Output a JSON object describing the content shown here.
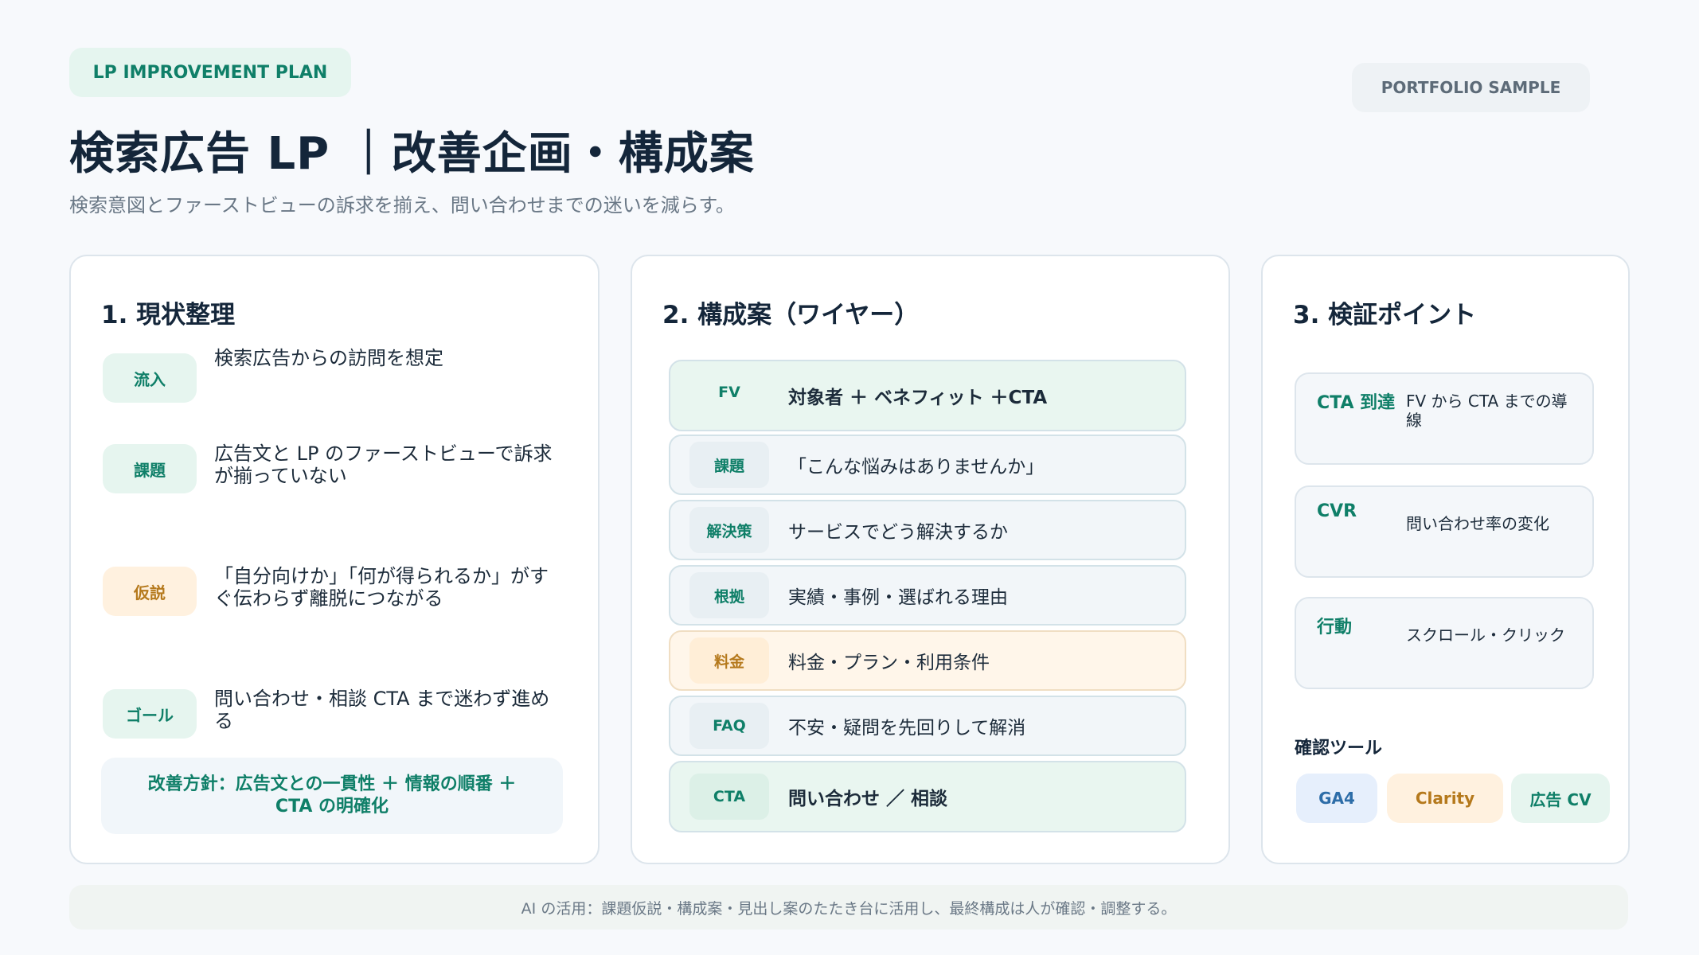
{
  "header": {
    "tag": "LP IMPROVEMENT PLAN",
    "portfolio": "PORTFOLIO SAMPLE",
    "title": "検索広告 LP ｜改善企画・構成案",
    "subtitle": "検索意図とファーストビューの訴求を揃え、問い合わせまでの迷いを減らす。"
  },
  "card1": {
    "title": "1. 現状整理",
    "rows": [
      {
        "badge": "流入",
        "text": "検索広告からの訪問を想定",
        "tone": "green"
      },
      {
        "badge": "課題",
        "text": "広告文と LP のファーストビューで訴求が揃っていない",
        "tone": "green"
      },
      {
        "badge": "仮説",
        "text": "「自分向けか」「何が得られるか」がすぐ伝わらず離脱につながる",
        "tone": "orange"
      },
      {
        "badge": "ゴール",
        "text": "問い合わせ・相談 CTA まで迷わず進める",
        "tone": "green"
      }
    ],
    "policy": "改善方針：広告文との一貫性 ＋ 情報の順番 ＋CTA の明確化"
  },
  "card2": {
    "title": "2. 構成案（ワイヤー）",
    "rows": [
      {
        "badge": "FV",
        "text": "対象者 ＋ ベネフィット ＋CTA"
      },
      {
        "badge": "課題",
        "text": "「こんな悩みはありませんか」"
      },
      {
        "badge": "解決策",
        "text": "サービスでどう解決するか"
      },
      {
        "badge": "根拠",
        "text": "実績・事例・選ばれる理由"
      },
      {
        "badge": "料金",
        "text": "料金・プラン・利用条件"
      },
      {
        "badge": "FAQ",
        "text": "不安・疑問を先回りして解消"
      },
      {
        "badge": "CTA",
        "text": "問い合わせ ／ 相談"
      }
    ]
  },
  "card3": {
    "title": "3. 検証ポイント",
    "points": [
      {
        "label": "CTA 到達",
        "desc": "FV から CTA までの導線"
      },
      {
        "label": "CVR",
        "desc": "問い合わせ率の変化"
      },
      {
        "label": "行動",
        "desc": "スクロール・クリック"
      }
    ],
    "tools_label": "確認ツール",
    "tools": [
      "GA4",
      "Clarity",
      "広告 CV"
    ]
  },
  "footer": "AI の活用：課題仮説・構成案・見出し案のたたき台に活用し、最終構成は人が確認・調整する。",
  "colors": {
    "accent_green": "#0f7f68",
    "accent_orange": "#b5791c",
    "accent_blue": "#2d6da8",
    "background": "#f7f9fc"
  }
}
